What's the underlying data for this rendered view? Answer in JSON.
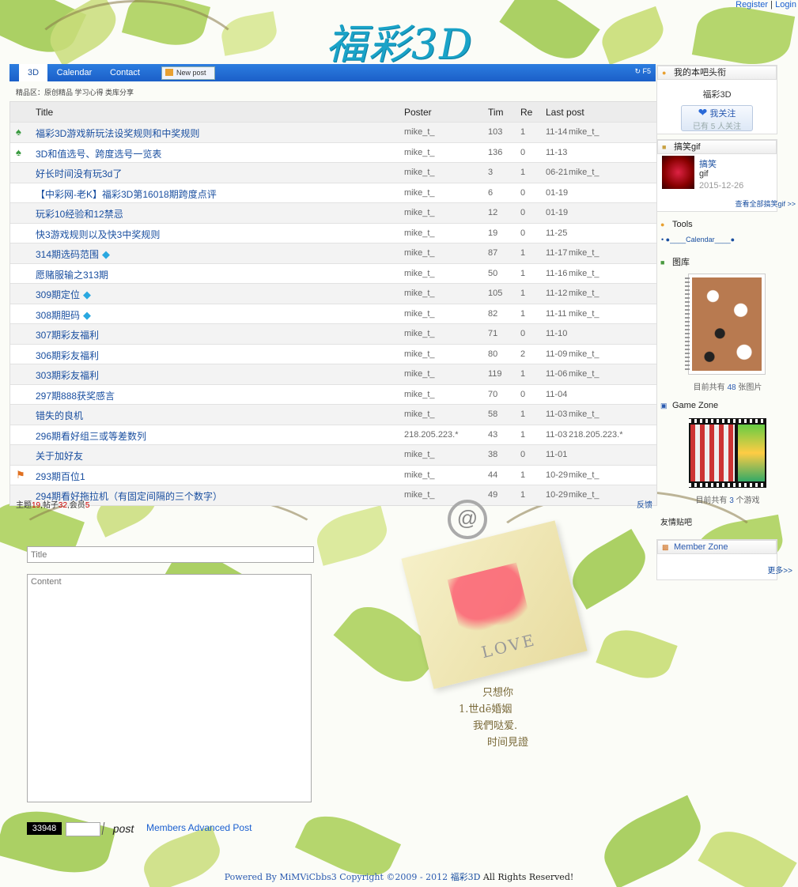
{
  "header": {
    "register": "Register",
    "separator": "|",
    "login": "Login",
    "logo_text": "福彩3D"
  },
  "nav": {
    "tabs": [
      "3D",
      "Calendar",
      "Contact"
    ],
    "new_post": "New post",
    "refresh": "F5"
  },
  "subnav": "精品区：原创精品  学习心得  类库分享",
  "table": {
    "columns": [
      "Title",
      "Poster",
      "Tim",
      "Re",
      "Last post"
    ],
    "rows": [
      {
        "icon": "game-icon",
        "title": "福彩3D游戏新玩法设奖规则和中奖规则",
        "gem": false,
        "poster": "mike_t_",
        "views": "103",
        "replies": "1",
        "date": "11-14",
        "last": "mike_t_"
      },
      {
        "icon": "game-icon",
        "title": "3D和值选号、跨度选号一览表",
        "gem": false,
        "poster": "mike_t_",
        "views": "136",
        "replies": "0",
        "date": "11-13",
        "last": ""
      },
      {
        "icon": "",
        "title": "好长时间没有玩3d了",
        "gem": false,
        "poster": "mike_t_",
        "views": "3",
        "replies": "1",
        "date": "06-21",
        "last": "mike_t_"
      },
      {
        "icon": "",
        "title": "【中彩网-老K】福彩3D第16018期跨度点评",
        "gem": false,
        "poster": "mike_t_",
        "views": "6",
        "replies": "0",
        "date": "01-19",
        "last": ""
      },
      {
        "icon": "",
        "title": "玩彩10经验和12禁忌",
        "gem": false,
        "poster": "mike_t_",
        "views": "12",
        "replies": "0",
        "date": "01-19",
        "last": ""
      },
      {
        "icon": "",
        "title": "快3游戏规则以及快3中奖规则",
        "gem": false,
        "poster": "mike_t_",
        "views": "19",
        "replies": "0",
        "date": "11-25",
        "last": ""
      },
      {
        "icon": "",
        "title": "314期选码范围",
        "gem": true,
        "poster": "mike_t_",
        "views": "87",
        "replies": "1",
        "date": "11-17",
        "last": "mike_t_"
      },
      {
        "icon": "",
        "title": "愿赌服输之313期",
        "gem": false,
        "poster": "mike_t_",
        "views": "50",
        "replies": "1",
        "date": "11-16",
        "last": "mike_t_"
      },
      {
        "icon": "",
        "title": "309期定位",
        "gem": true,
        "poster": "mike_t_",
        "views": "105",
        "replies": "1",
        "date": "11-12",
        "last": "mike_t_"
      },
      {
        "icon": "",
        "title": "308期胆码",
        "gem": true,
        "poster": "mike_t_",
        "views": "82",
        "replies": "1",
        "date": "11-11",
        "last": "mike_t_"
      },
      {
        "icon": "",
        "title": "307期彩友福利",
        "gem": false,
        "poster": "mike_t_",
        "views": "71",
        "replies": "0",
        "date": "11-10",
        "last": ""
      },
      {
        "icon": "",
        "title": "306期彩友福利",
        "gem": false,
        "poster": "mike_t_",
        "views": "80",
        "replies": "2",
        "date": "11-09",
        "last": "mike_t_"
      },
      {
        "icon": "",
        "title": "303期彩友福利",
        "gem": false,
        "poster": "mike_t_",
        "views": "119",
        "replies": "1",
        "date": "11-06",
        "last": "mike_t_"
      },
      {
        "icon": "",
        "title": "297期888获奖感言",
        "gem": false,
        "poster": "mike_t_",
        "views": "70",
        "replies": "0",
        "date": "11-04",
        "last": ""
      },
      {
        "icon": "",
        "title": "错失的良机",
        "gem": false,
        "poster": "mike_t_",
        "views": "58",
        "replies": "1",
        "date": "11-03",
        "last": "mike_t_"
      },
      {
        "icon": "",
        "title": "296期看好组三或等差数列",
        "gem": false,
        "poster": "218.205.223.*",
        "views": "43",
        "replies": "1",
        "date": "11-03",
        "last": "218.205.223.*"
      },
      {
        "icon": "",
        "title": "关于加好友",
        "gem": false,
        "poster": "mike_t_",
        "views": "38",
        "replies": "0",
        "date": "11-01",
        "last": ""
      },
      {
        "icon": "flag-icon",
        "title": "293期百位1",
        "gem": false,
        "poster": "mike_t_",
        "views": "44",
        "replies": "1",
        "date": "10-29",
        "last": "mike_t_"
      },
      {
        "icon": "",
        "title": "294期看好拖拉机（有固定间隔的三个数字）",
        "gem": false,
        "poster": "mike_t_",
        "views": "49",
        "replies": "1",
        "date": "10-29",
        "last": "mike_t_"
      }
    ]
  },
  "stats": {
    "topics_label": "主题",
    "topics": "19",
    "posts_label": ",帖子",
    "posts": "32",
    "members_label": ",会员",
    "members": "5",
    "feedback": "反馈"
  },
  "form": {
    "title_placeholder": "Title",
    "content_placeholder": "Content",
    "captcha": "33948",
    "post_label": "post",
    "advanced_link": "Members Advanced Post"
  },
  "footer": {
    "powered": "Powered By MiMViCbbs3 Copyright ©2009 - 2012 ",
    "site": "福彩3D",
    "rights": " All Rights Reserved!"
  },
  "sidebar": {
    "my_bar": {
      "heading": "我的本吧头衔",
      "name": "福彩3D",
      "follow_label": "我关注",
      "follow_count": "已有 5 人关注"
    },
    "gif": {
      "heading": "搞笑gif",
      "item_title": "搞笑",
      "item_desc": "gif",
      "item_date": "2015-12-26",
      "more": "查看全部搞笑gif >>"
    },
    "tools": {
      "heading": "Tools",
      "item": "●____Calendar____●"
    },
    "gallery": {
      "heading": "图库",
      "caption_pre": "目前共有 ",
      "count": "48",
      "caption_post": " 张图片"
    },
    "game": {
      "heading": "Game Zone",
      "caption_pre": "目前共有 ",
      "count": "3",
      "caption_post": " 个游戏"
    },
    "friends": "友情贴吧",
    "members": {
      "heading": "Member Zone",
      "more": "更多>>"
    }
  },
  "decor": {
    "love": "LOVE",
    "poem": [
      "只想你",
      "1.世dē婚姻",
      "我們哒爱.",
      "时间見證"
    ]
  }
}
